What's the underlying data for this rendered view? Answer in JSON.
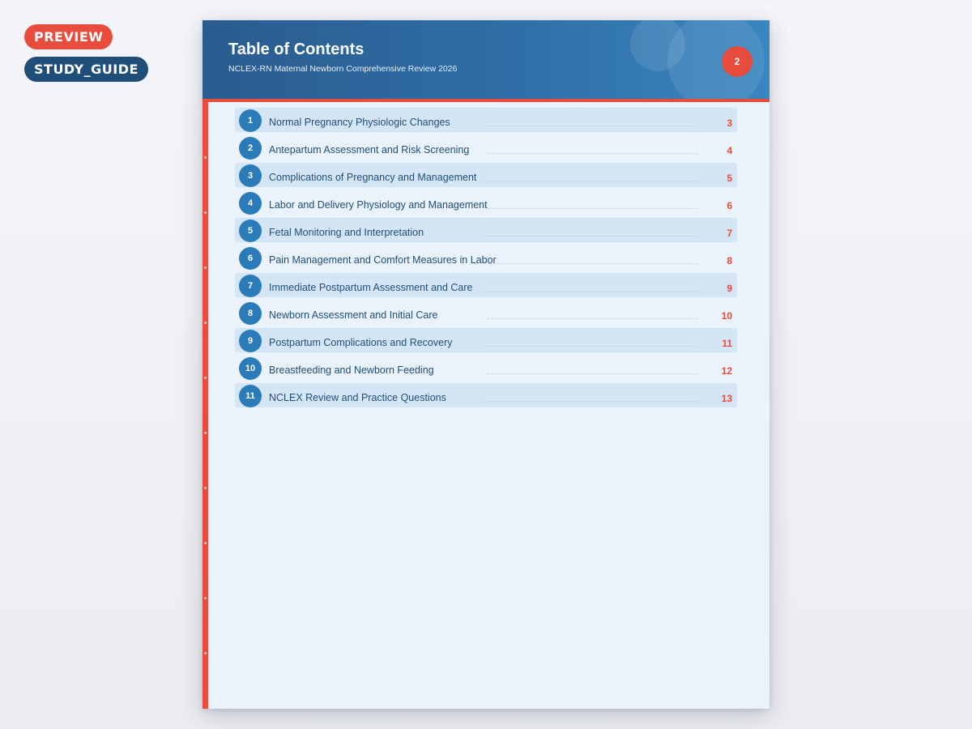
{
  "badges": {
    "preview": "PREVIEW",
    "type": "STUDY_GUIDE"
  },
  "header": {
    "title": "Table of Contents",
    "subtitle": "NCLEX-RN Maternal Newborn Comprehensive Review 2026",
    "page_number": "2"
  },
  "colors": {
    "accent": "#e74c3c",
    "primary": "#2b7bb9",
    "text": "#1f4e79"
  },
  "toc": [
    {
      "number": "1",
      "title": "Normal Pregnancy Physiologic Changes",
      "page": "3"
    },
    {
      "number": "2",
      "title": "Antepartum Assessment and Risk Screening",
      "page": "4"
    },
    {
      "number": "3",
      "title": "Complications of Pregnancy and Management",
      "page": "5"
    },
    {
      "number": "4",
      "title": "Labor and Delivery Physiology and Management",
      "page": "6"
    },
    {
      "number": "5",
      "title": "Fetal Monitoring and Interpretation",
      "page": "7"
    },
    {
      "number": "6",
      "title": "Pain Management and Comfort Measures in Labor",
      "page": "8"
    },
    {
      "number": "7",
      "title": "Immediate Postpartum Assessment and Care",
      "page": "9"
    },
    {
      "number": "8",
      "title": "Newborn Assessment and Initial Care",
      "page": "10"
    },
    {
      "number": "9",
      "title": "Postpartum Complications and Recovery",
      "page": "11"
    },
    {
      "number": "10",
      "title": "Breastfeeding and Newborn Feeding",
      "page": "12"
    },
    {
      "number": "11",
      "title": "NCLEX Review and Practice Questions",
      "page": "13"
    }
  ]
}
